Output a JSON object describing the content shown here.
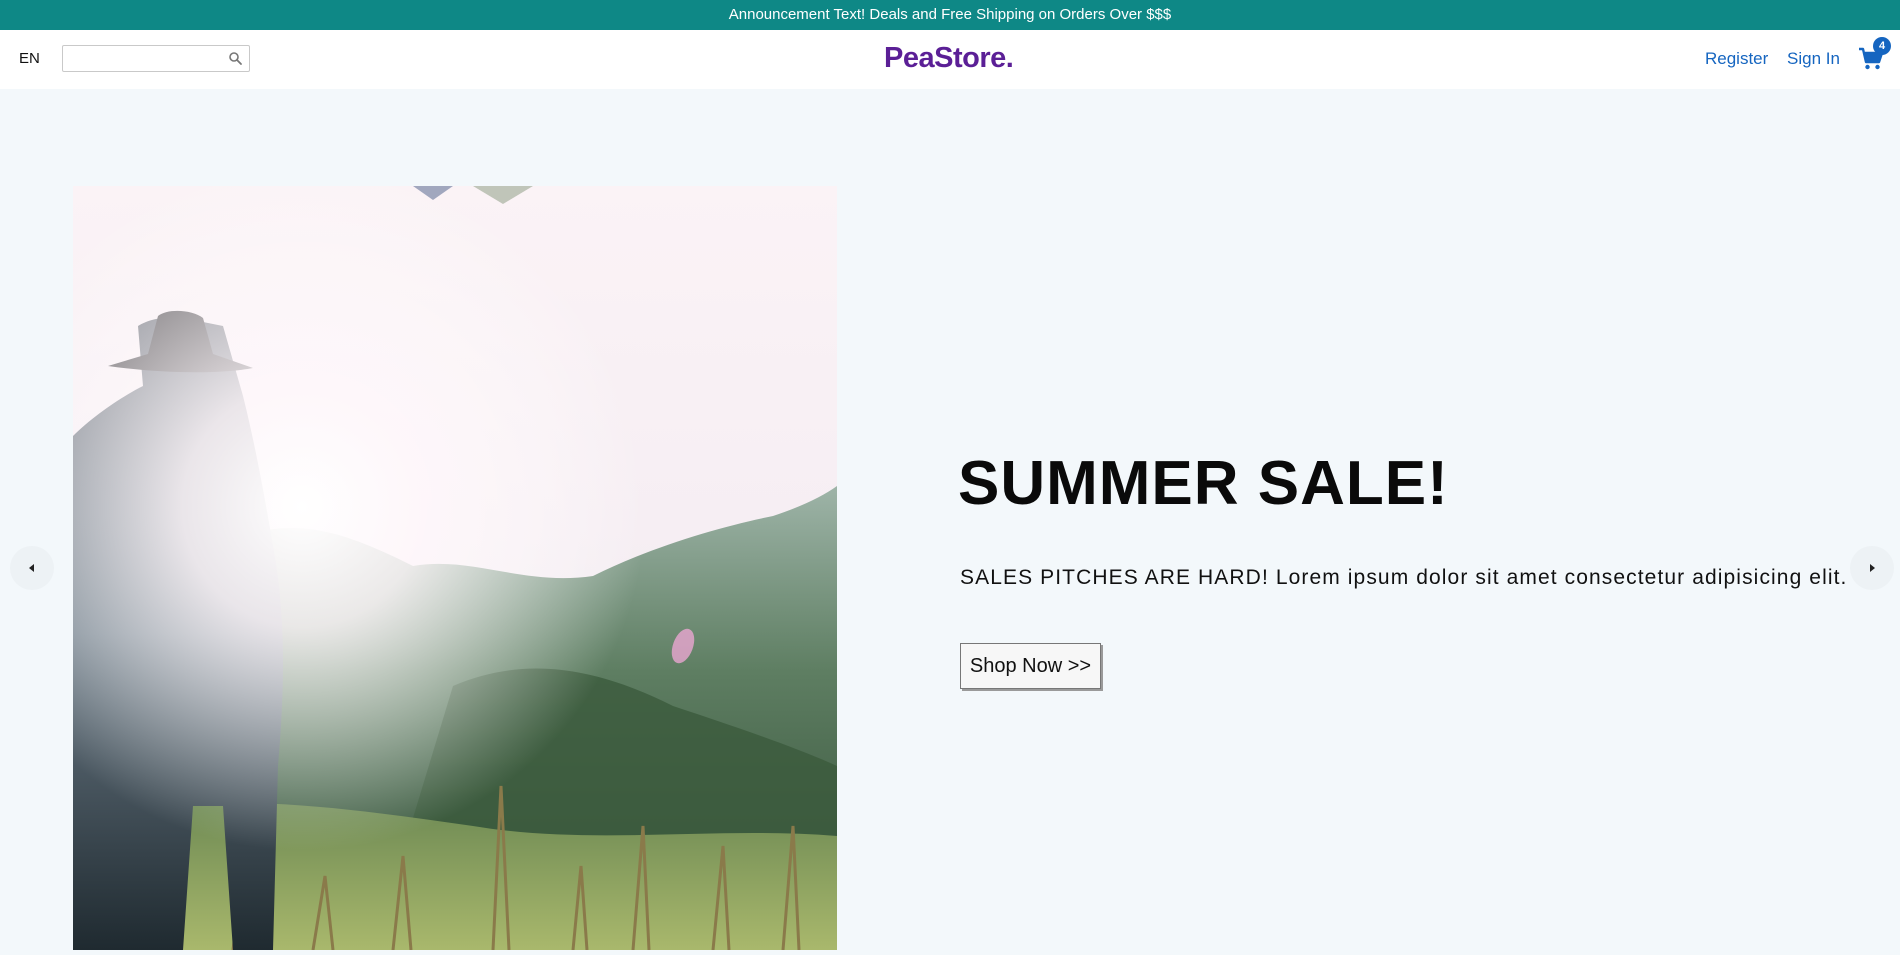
{
  "announcement": {
    "text": "Announcement Text! Deals and Free Shipping on Orders Over $$$"
  },
  "header": {
    "language": "EN",
    "search": {
      "value": "",
      "placeholder": "",
      "icon": "search-icon"
    },
    "logo": "PeaStore.",
    "nav": {
      "register": "Register",
      "sign_in": "Sign In"
    },
    "cart": {
      "icon": "cart-icon",
      "count": "4"
    }
  },
  "hero": {
    "image": "man-in-hat-standing-in-sunlit-meadow",
    "title": "SUMMER SALE!",
    "subtitle": "SALES PITCHES ARE HARD! Lorem ipsum dolor sit amet consectetur adipisicing elit.",
    "cta": "Shop Now >>"
  },
  "carousel": {
    "prev_icon": "chevron-left-icon",
    "next_icon": "chevron-right-icon"
  },
  "colors": {
    "announcement_bg": "#0e8886",
    "logo": "#5b1f96",
    "link": "#1565c0",
    "page_bg": "#f3f8fb"
  }
}
